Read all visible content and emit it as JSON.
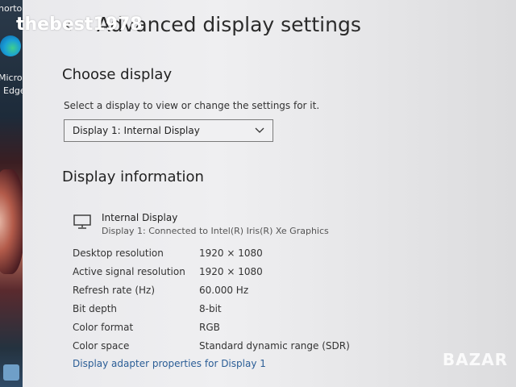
{
  "desktop": {
    "icon_labels": [
      "horto",
      "Micros",
      "Edge"
    ]
  },
  "watermark": "thebest1978",
  "window": {
    "title": "Advanced display settings"
  },
  "choose_display": {
    "heading": "Choose display",
    "hint": "Select a display to view or change the settings for it.",
    "selected": "Display 1: Internal Display"
  },
  "display_info": {
    "heading": "Display information",
    "name": "Internal Display",
    "connection": "Display 1: Connected to Intel(R) Iris(R) Xe Graphics",
    "rows": [
      {
        "label": "Desktop resolution",
        "value": "1920 × 1080"
      },
      {
        "label": "Active signal resolution",
        "value": "1920 × 1080"
      },
      {
        "label": "Refresh rate (Hz)",
        "value": "60.000 Hz"
      },
      {
        "label": "Bit depth",
        "value": "8-bit"
      },
      {
        "label": "Color format",
        "value": "RGB"
      },
      {
        "label": "Color space",
        "value": "Standard dynamic range (SDR)"
      }
    ],
    "adapter_link": "Display adapter properties for Display 1"
  },
  "brand_watermark": "BAZAR",
  "colors": {
    "link": "#2a5d96",
    "text": "#222222",
    "window_bg": "#ececef"
  }
}
